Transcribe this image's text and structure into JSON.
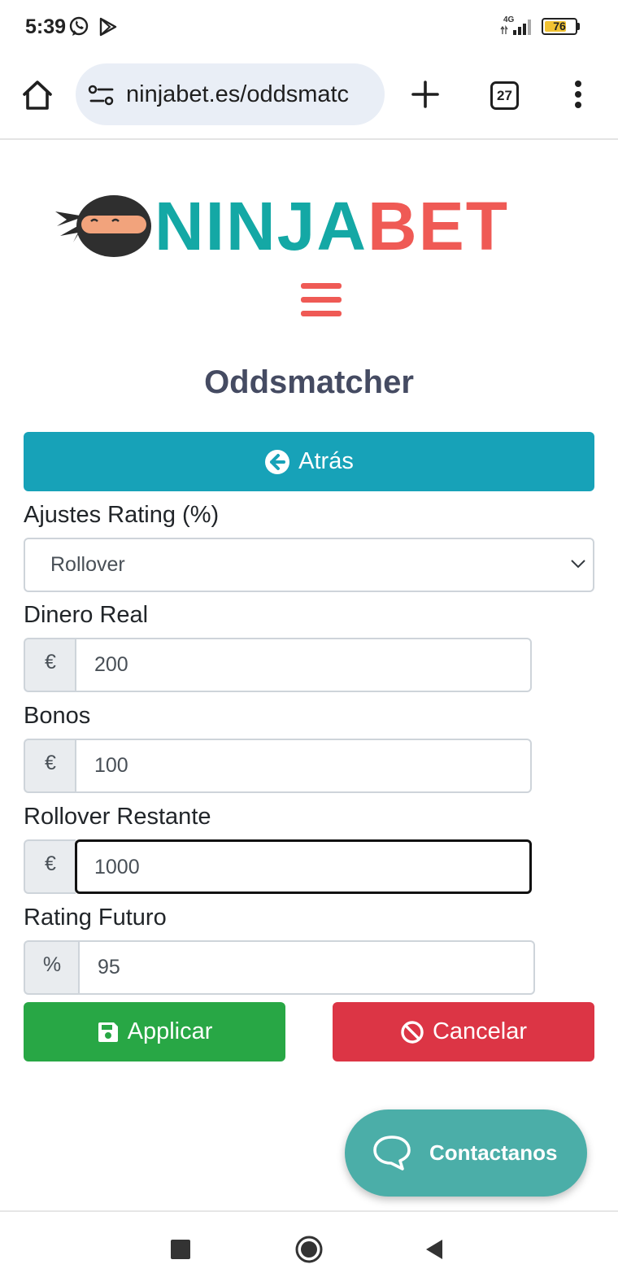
{
  "status_bar": {
    "time": "5:39",
    "network": "4G",
    "battery": "76",
    "battery_level": 0.76,
    "battery_color": "#f1c232"
  },
  "browser": {
    "url": "ninjabet.es/oddsmatc",
    "tab_count": "27",
    "icons": [
      "home-icon",
      "site-settings-icon",
      "new-tab-icon",
      "tab-switcher-icon",
      "more-menu-icon"
    ]
  },
  "logo": {
    "part1": "NINJA",
    "part2": "BET",
    "color_part1": "#14a8a5",
    "color_part2": "#ef5a55"
  },
  "page": {
    "title": "Oddsmatcher",
    "back_label": "Atrás",
    "rating_settings_label": "Ajustes Rating (%)",
    "rating_settings_value": "Rollover",
    "fields": [
      {
        "label": "Dinero Real",
        "addon": "€",
        "value": "200"
      },
      {
        "label": "Bonos",
        "addon": "€",
        "value": "100"
      },
      {
        "label": "Rollover Restante",
        "addon": "€",
        "value": "1000"
      },
      {
        "label": "Rating Futuro",
        "addon": "%",
        "value": "95"
      }
    ],
    "apply_label": "Applicar",
    "cancel_label": "Cancelar",
    "contact_label": "Contactanos"
  },
  "colors": {
    "info": "#17a2b8",
    "success": "#28a745",
    "danger": "#dc3545",
    "chat": "#4baea8",
    "title": "#454b62"
  }
}
